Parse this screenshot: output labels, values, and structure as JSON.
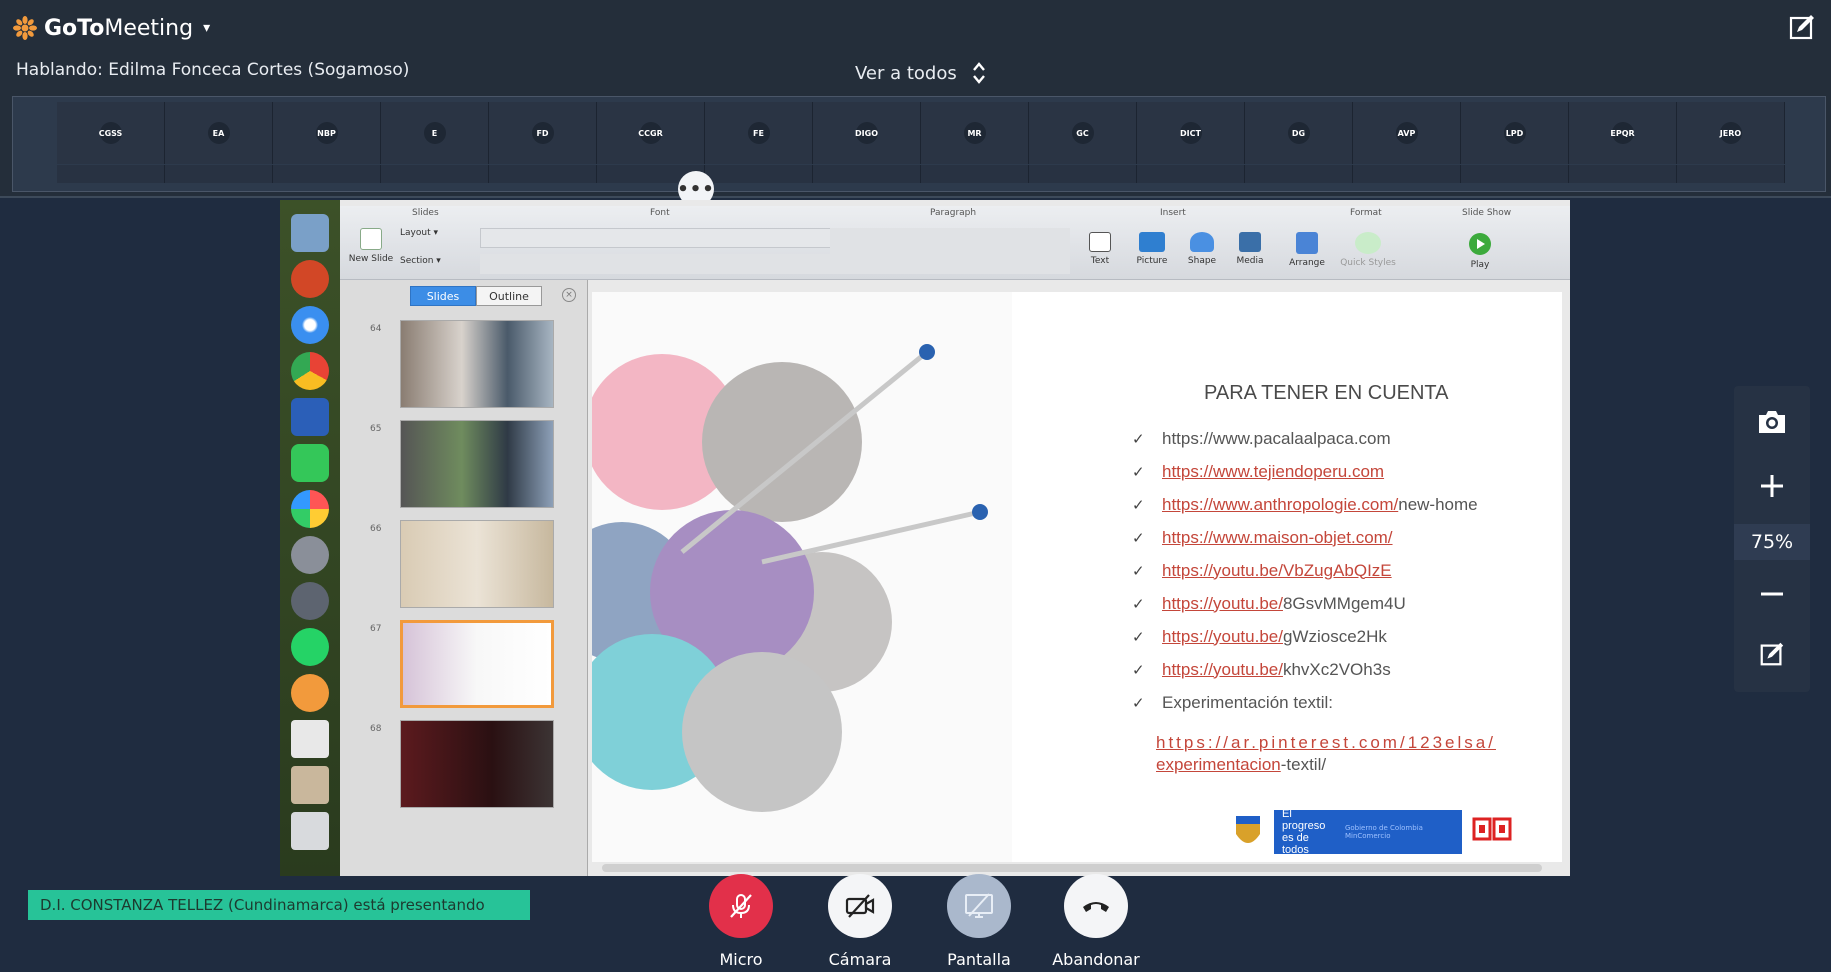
{
  "app": {
    "brand_bold": "GoTo",
    "brand_light": "Meeting",
    "brand_caret": "▾"
  },
  "header": {
    "speaking": "Hablando: Edilma Fonceca Cortes (Sogamoso)",
    "view_all": "Ver a todos"
  },
  "attendees": [
    "CGSS",
    "EA",
    "NBP",
    "E",
    "FD",
    "CCGR",
    "FE",
    "DIGO",
    "MR",
    "GC",
    "DICT",
    "DG",
    "AVP",
    "LPD",
    "EPQR",
    "JERO"
  ],
  "more_label": "•••",
  "ppt": {
    "ribbon_groups": [
      "Slides",
      "Font",
      "Paragraph",
      "Insert",
      "Format",
      "Slide Show"
    ],
    "ribbon_buttons": {
      "new_slide": "New Slide",
      "layout": "Layout ▾",
      "section": "Section ▾",
      "text": "Text",
      "picture": "Picture",
      "shape": "Shape",
      "media": "Media",
      "arrange": "Arrange",
      "quick_styles": "Quick Styles",
      "play": "Play"
    },
    "tabs": [
      "Slides",
      "Outline"
    ],
    "slide_numbers": [
      "64",
      "65",
      "66",
      "67",
      "68"
    ]
  },
  "slide": {
    "title": "PARA TENER EN CUENTA",
    "check": "✓",
    "links": [
      {
        "u": "",
        "n": "https://www.pacalaalpaca.com"
      },
      {
        "u": "https://www.tejiendoperu.com",
        "n": ""
      },
      {
        "u": "https://www.anthropologie.com/",
        "n": "new-home"
      },
      {
        "u": "https://www.maison-objet.com/",
        "n": ""
      },
      {
        "u": "https://youtu.be/VbZugAbQIzE",
        "n": ""
      },
      {
        "u": "https://youtu.be/",
        "n": "8GsvMMgem4U"
      },
      {
        "u": "https://youtu.be/",
        "n": "gWziosce2Hk"
      },
      {
        "u": "https://youtu.be/",
        "n": "khvXc2VOh3s"
      },
      {
        "u": "",
        "n": "Experimentación textil:"
      }
    ],
    "pinterest_a": "https://ar.pinterest.com/123elsa/",
    "pinterest_b": "experimentacion",
    "pinterest_c": "-textil/",
    "gov_line1": "El progreso",
    "gov_line2": "es de todos",
    "gov_small": "Gobierno de Colombia MinComercio"
  },
  "zoom": {
    "value": "75%"
  },
  "presenting": "D.I. CONSTANZA TELLEZ (Cundinamarca) está presentando",
  "controls": {
    "micro": "Micro",
    "camara": "Cámara",
    "pantalla": "Pantalla",
    "abandonar": "Abandonar"
  },
  "colors": {
    "bg": "#1f2c40",
    "mic_red": "#e2304a",
    "presenting_green": "#27c398",
    "logo_orange": "#f29a3c",
    "link_red": "#c4463a"
  }
}
